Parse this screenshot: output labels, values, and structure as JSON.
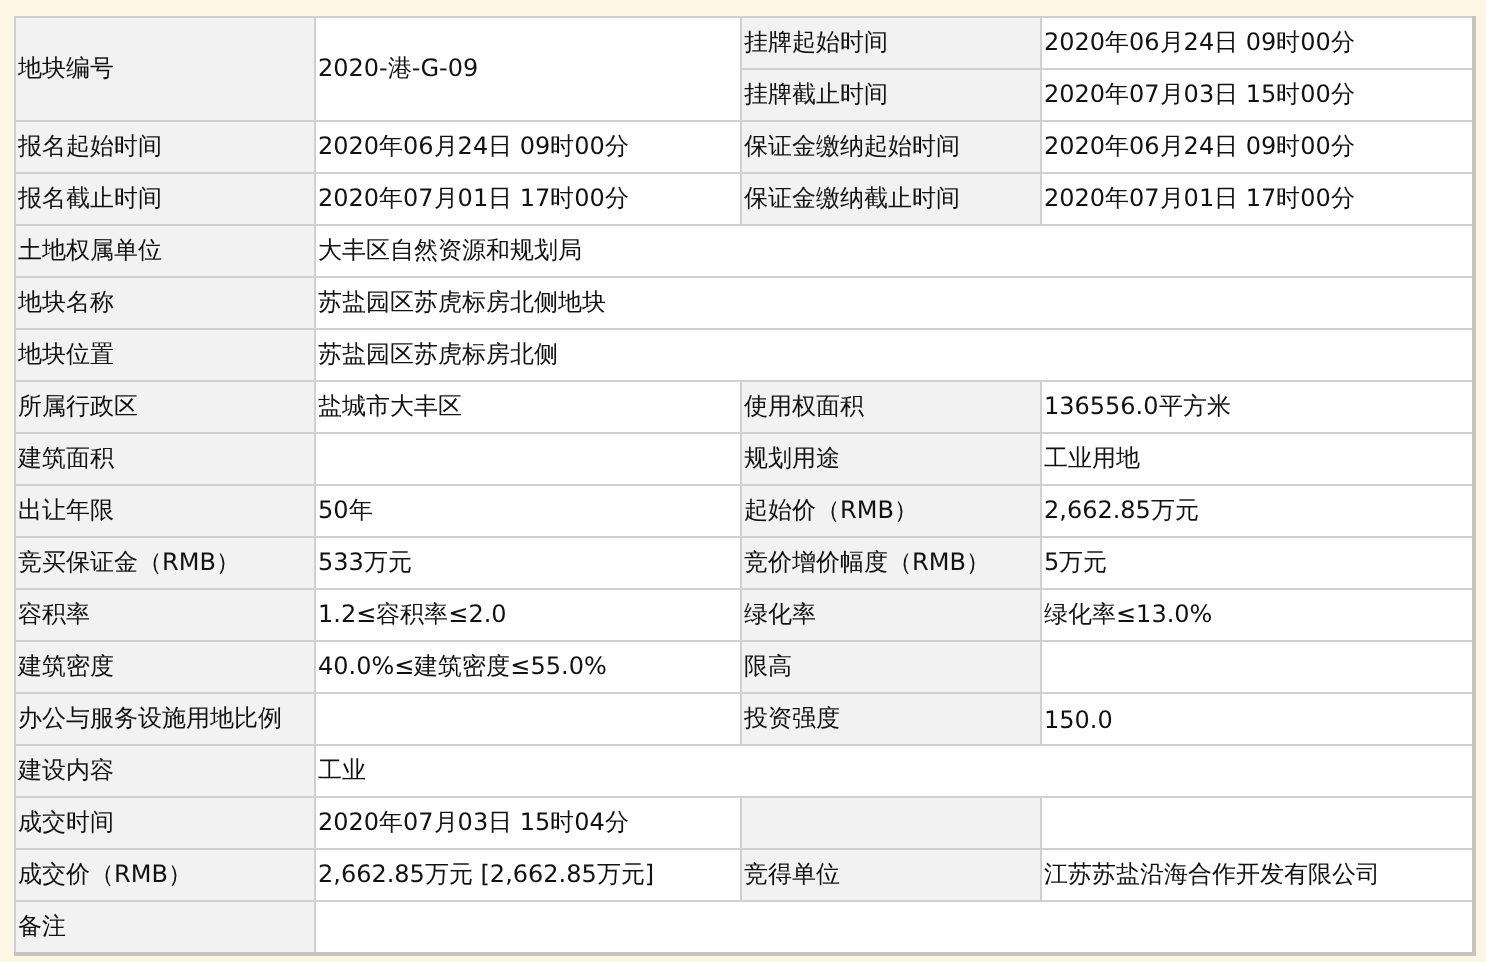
{
  "rows": [
    {
      "cells": [
        {
          "kind": "label",
          "text": "地块编号",
          "tall": true
        },
        {
          "kind": "value",
          "text": "2020-港-G-09",
          "tall": true
        },
        {
          "kind": "label",
          "text": "挂牌起始时间"
        },
        {
          "kind": "value",
          "text": "2020年06月24日 09时00分"
        }
      ]
    },
    {
      "cells": [
        {
          "kind": "label",
          "text": "挂牌截止时间"
        },
        {
          "kind": "value",
          "text": "2020年07月03日 15时00分"
        }
      ]
    },
    {
      "cells": [
        {
          "kind": "label",
          "text": "报名起始时间"
        },
        {
          "kind": "value",
          "text": "2020年06月24日 09时00分"
        },
        {
          "kind": "label",
          "text": "保证金缴纳起始时间"
        },
        {
          "kind": "value",
          "text": "2020年06月24日 09时00分"
        }
      ]
    },
    {
      "cells": [
        {
          "kind": "label",
          "text": "报名截止时间"
        },
        {
          "kind": "value",
          "text": "2020年07月01日 17时00分"
        },
        {
          "kind": "label",
          "text": "保证金缴纳截止时间"
        },
        {
          "kind": "value",
          "text": "2020年07月01日 17时00分"
        }
      ]
    },
    {
      "cells": [
        {
          "kind": "label",
          "text": "土地权属单位"
        },
        {
          "kind": "value",
          "text": "大丰区自然资源和规划局"
        }
      ]
    },
    {
      "cells": [
        {
          "kind": "label",
          "text": "地块名称"
        },
        {
          "kind": "value",
          "text": "苏盐园区苏虎标房北侧地块"
        }
      ]
    },
    {
      "cells": [
        {
          "kind": "label",
          "text": "地块位置"
        },
        {
          "kind": "value",
          "text": "苏盐园区苏虎标房北侧"
        }
      ]
    },
    {
      "cells": [
        {
          "kind": "label",
          "text": "所属行政区"
        },
        {
          "kind": "value",
          "text": "盐城市大丰区"
        },
        {
          "kind": "label",
          "text": "使用权面积"
        },
        {
          "kind": "value",
          "text": "136556.0平方米"
        }
      ]
    },
    {
      "cells": [
        {
          "kind": "label",
          "text": "建筑面积"
        },
        {
          "kind": "value"
        },
        {
          "kind": "label",
          "text": "规划用途"
        },
        {
          "kind": "value",
          "text": "工业用地"
        }
      ]
    },
    {
      "cells": [
        {
          "kind": "label",
          "text": "出让年限"
        },
        {
          "kind": "value",
          "text": "50年"
        },
        {
          "kind": "label",
          "text": "起始价（RMB）"
        },
        {
          "kind": "value",
          "text": "2,662.85万元"
        }
      ]
    },
    {
      "cells": [
        {
          "kind": "label",
          "text": "竞买保证金（RMB）"
        },
        {
          "kind": "value",
          "text": "533万元"
        },
        {
          "kind": "label",
          "text": "竞价增价幅度（RMB）"
        },
        {
          "kind": "value",
          "text": "5万元"
        }
      ]
    },
    {
      "cells": [
        {
          "kind": "label",
          "text": "容积率"
        },
        {
          "kind": "value",
          "text": "1.2≤容积率≤2.0"
        },
        {
          "kind": "label",
          "text": "绿化率"
        },
        {
          "kind": "value",
          "text": "绿化率≤13.0%"
        }
      ]
    },
    {
      "cells": [
        {
          "kind": "label",
          "text": "建筑密度"
        },
        {
          "kind": "value",
          "text": "40.0%≤建筑密度≤55.0%"
        },
        {
          "kind": "label",
          "text": "限高"
        },
        {
          "kind": "value"
        }
      ]
    },
    {
      "cells": [
        {
          "kind": "label",
          "text": "办公与服务设施用地比例"
        },
        {
          "kind": "value"
        },
        {
          "kind": "label",
          "text": "投资强度"
        },
        {
          "kind": "value",
          "text": "150.0"
        }
      ]
    },
    {
      "cells": [
        {
          "kind": "label",
          "text": "建设内容"
        },
        {
          "kind": "value",
          "text": "工业"
        }
      ]
    },
    {
      "cells": [
        {
          "kind": "label",
          "text": "成交时间"
        },
        {
          "kind": "value",
          "text": "2020年07月03日 15时04分"
        },
        {
          "kind": "label"
        },
        {
          "kind": "value"
        }
      ]
    },
    {
      "cells": [
        {
          "kind": "label",
          "text": "成交价（RMB）"
        },
        {
          "kind": "value",
          "text": "2,662.85万元 [2,662.85万元]"
        },
        {
          "kind": "label",
          "text": "竞得单位"
        },
        {
          "kind": "value",
          "text": "江苏苏盐沿海合作开发有限公司"
        }
      ]
    },
    {
      "cells": [
        {
          "kind": "label",
          "text": "备注"
        },
        {
          "kind": "value"
        }
      ]
    }
  ]
}
